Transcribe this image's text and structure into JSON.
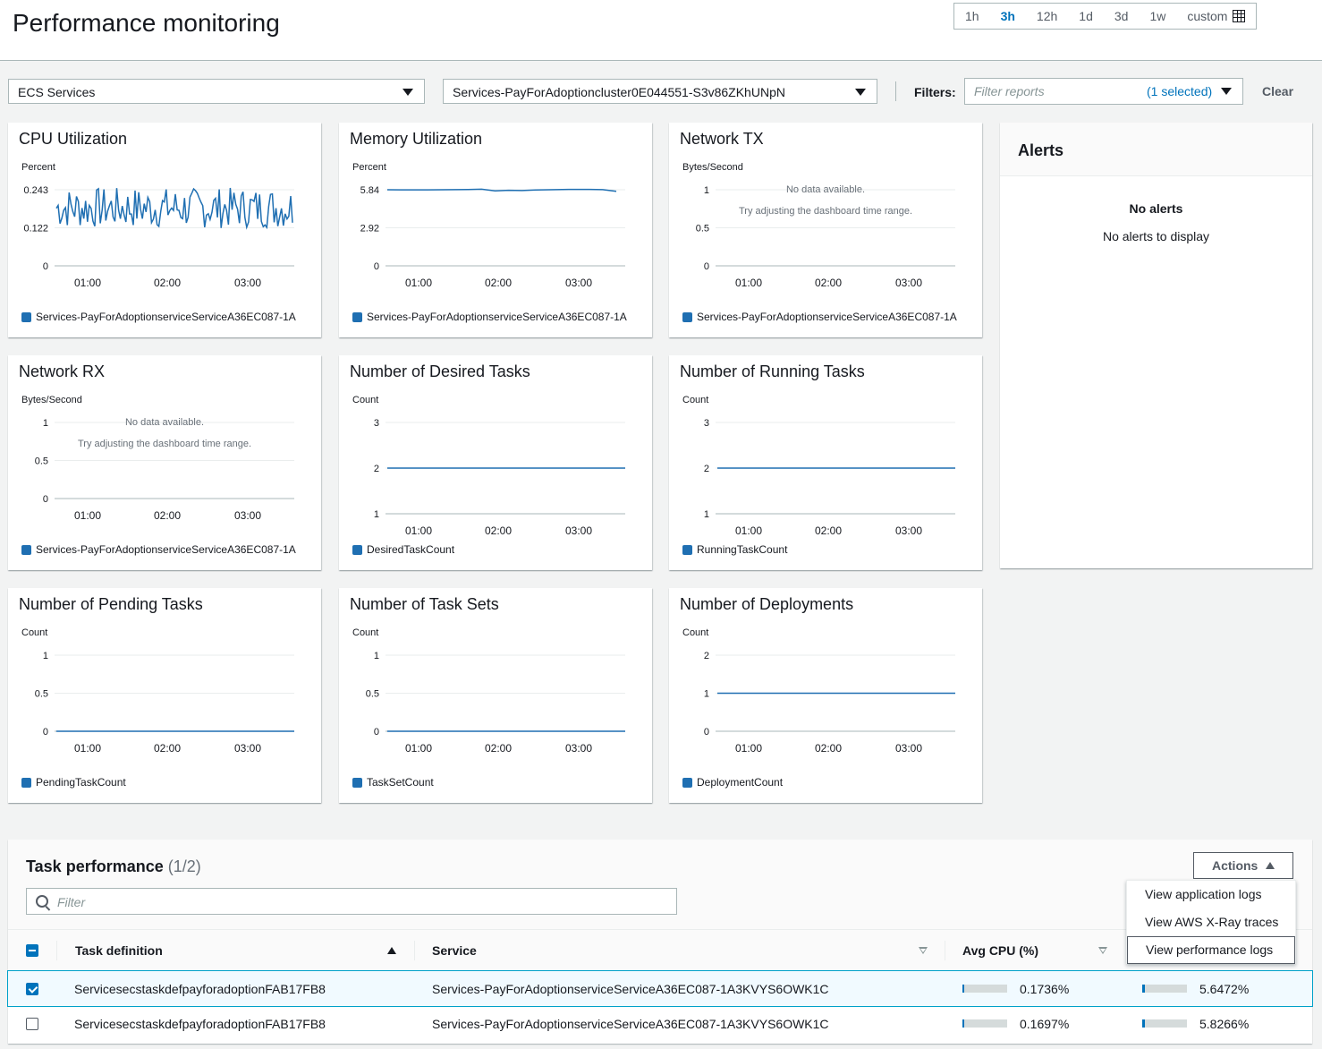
{
  "header": {
    "title": "Performance monitoring",
    "time_ranges": [
      "1h",
      "3h",
      "12h",
      "1d",
      "3d",
      "1w"
    ],
    "active_range": "3h",
    "custom_label": "custom",
    "icons": {
      "calendar": "calendar-icon"
    }
  },
  "toolbar": {
    "resource_type": "ECS Services",
    "resource": "Services-PayForAdoptioncluster0E044551-S3v86ZKhUNpN",
    "filters_label": "Filters:",
    "filter_placeholder": "Filter reports",
    "filter_selected": "(1 selected)",
    "clear_label": "Clear"
  },
  "colors": {
    "series": "#1f6fb2",
    "accent": "#0073bb"
  },
  "charts": [
    {
      "title": "CPU Utilization",
      "unit": "Percent",
      "type": "line",
      "yticks": [
        "0.243",
        "0.122",
        "0"
      ],
      "ymax": 0.243,
      "xticks": [
        "01:00",
        "02:00",
        "03:00"
      ],
      "legend": "Services-PayForAdoptionserviceServiceA36EC087-1A",
      "noisy": true,
      "series": [
        0.12,
        0.25
      ]
    },
    {
      "title": "Memory Utilization",
      "unit": "Percent",
      "type": "line",
      "yticks": [
        "5.84",
        "2.92",
        "0"
      ],
      "ymax": 5.84,
      "xticks": [
        "01:00",
        "02:00",
        "03:00"
      ],
      "legend": "Services-PayForAdoptionserviceServiceA36EC087-1A",
      "series": [
        5.84,
        5.83,
        5.83,
        5.83,
        5.84,
        5.85,
        5.86,
        5.88,
        5.75,
        5.8,
        5.78,
        5.82,
        5.84,
        5.86,
        5.87,
        5.87,
        5.85,
        5.72
      ]
    },
    {
      "title": "Network TX",
      "unit": "Bytes/Second",
      "type": "empty",
      "yticks": [
        "1",
        "0.5",
        "0"
      ],
      "xticks": [
        "01:00",
        "02:00",
        "03:00"
      ],
      "legend": "Services-PayForAdoptionserviceServiceA36EC087-1A",
      "nodata": "No data available.",
      "nodata_hint": "Try adjusting the dashboard time range."
    },
    {
      "title": "Network RX",
      "unit": "Bytes/Second",
      "type": "empty",
      "yticks": [
        "1",
        "0.5",
        "0"
      ],
      "xticks": [
        "01:00",
        "02:00",
        "03:00"
      ],
      "legend": "Services-PayForAdoptionserviceServiceA36EC087-1A",
      "nodata": "No data available.",
      "nodata_hint": "Try adjusting the dashboard time range."
    },
    {
      "title": "Number of Desired Tasks",
      "unit": "Count",
      "type": "flat",
      "yticks": [
        "3",
        "2",
        "1"
      ],
      "xticks": [
        "01:00",
        "02:00",
        "03:00"
      ],
      "legend": "DesiredTaskCount",
      "value": 2,
      "ymin": 1,
      "ymax": 3
    },
    {
      "title": "Number of Running Tasks",
      "unit": "Count",
      "type": "flat",
      "yticks": [
        "3",
        "2",
        "1"
      ],
      "xticks": [
        "01:00",
        "02:00",
        "03:00"
      ],
      "legend": "RunningTaskCount",
      "value": 2,
      "ymin": 1,
      "ymax": 3
    },
    {
      "title": "Number of Pending Tasks",
      "unit": "Count",
      "type": "flat",
      "yticks": [
        "1",
        "0.5",
        "0"
      ],
      "xticks": [
        "01:00",
        "02:00",
        "03:00"
      ],
      "legend": "PendingTaskCount",
      "value": 0,
      "ymin": 0,
      "ymax": 1
    },
    {
      "title": "Number of Task Sets",
      "unit": "Count",
      "type": "flat",
      "yticks": [
        "1",
        "0.5",
        "0"
      ],
      "xticks": [
        "01:00",
        "02:00",
        "03:00"
      ],
      "legend": "TaskSetCount",
      "value": 0,
      "ymin": 0,
      "ymax": 1
    },
    {
      "title": "Number of Deployments",
      "unit": "Count",
      "type": "flat",
      "yticks": [
        "2",
        "1",
        "0"
      ],
      "xticks": [
        "01:00",
        "02:00",
        "03:00"
      ],
      "legend": "DeploymentCount",
      "value": 1,
      "ymin": 0,
      "ymax": 2
    }
  ],
  "alerts": {
    "title": "Alerts",
    "empty_title": "No alerts",
    "empty_text": "No alerts to display"
  },
  "task_performance": {
    "title": "Task performance",
    "count": "(1/2)",
    "actions_label": "Actions",
    "filter_placeholder": "Filter",
    "columns": [
      "Task definition",
      "Service",
      "Avg CPU (%)"
    ],
    "rows": [
      {
        "selected": true,
        "task_definition": "ServicesecstaskdefpayforadoptionFAB17FB8",
        "service": "Services-PayForAdoptionserviceServiceA36EC087-1A3KVYS6OWK1C",
        "cpu": "0.1736%",
        "cpu_fraction": 0.04,
        "mem": "5.6472%",
        "mem_fraction": 0.05
      },
      {
        "selected": false,
        "task_definition": "ServicesecstaskdefpayforadoptionFAB17FB8",
        "service": "Services-PayForAdoptionserviceServiceA36EC087-1A3KVYS6OWK1C",
        "cpu": "0.1697%",
        "cpu_fraction": 0.04,
        "mem": "5.8266%",
        "mem_fraction": 0.05
      }
    ],
    "menu": [
      "View application logs",
      "View AWS X-Ray traces",
      "View performance logs"
    ]
  }
}
